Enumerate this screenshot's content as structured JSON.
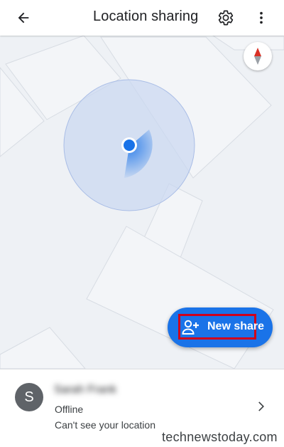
{
  "appbar": {
    "title": "Location sharing",
    "back_icon": "arrow-back-icon",
    "settings_icon": "gear-icon",
    "more_icon": "more-vert-icon"
  },
  "map": {
    "compass_icon": "compass-icon",
    "my_location_color": "#1a73e8",
    "accuracy_color": "#c9d7f1"
  },
  "fab": {
    "label": "New share",
    "icon": "person-add-icon",
    "color": "#1a73e8",
    "highlight_color": "#d0021b"
  },
  "contact": {
    "initial": "S",
    "name": "Sarah Frank",
    "status": "Offline",
    "description": "Can't see your location",
    "chevron_icon": "chevron-right-icon"
  },
  "watermark": "technewstoday.com"
}
